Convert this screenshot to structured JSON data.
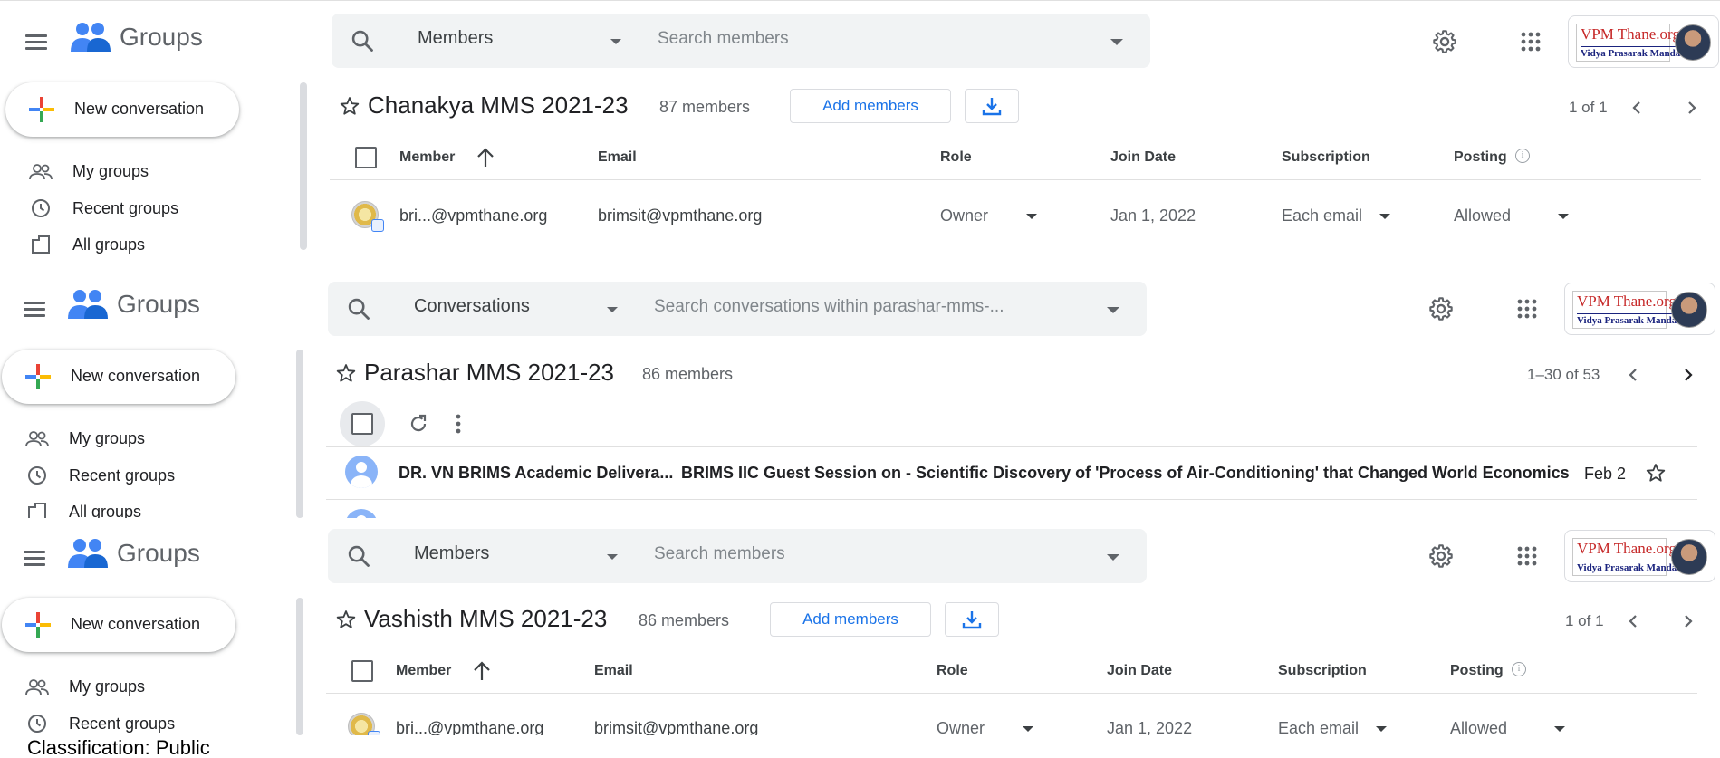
{
  "app": {
    "name": "Groups",
    "new_conversation_label": "New conversation"
  },
  "nav": {
    "my_groups": "My groups",
    "recent_groups": "Recent groups",
    "all_groups": "All groups"
  },
  "brand": {
    "line1": "VPM Thane.org",
    "line2": "Vidya Prasarak Mandal"
  },
  "colors": {
    "accent": "#1a73e8",
    "search_bg": "#f1f3f4",
    "muted": "#5f6368"
  },
  "panels": [
    {
      "search": {
        "scope": "Members",
        "placeholder": "Search members"
      },
      "group": {
        "title": "Chanakya MMS 2021-23",
        "member_count": "87 members"
      },
      "add_members_label": "Add members",
      "pager": "1 of 1",
      "table": {
        "headers": {
          "member": "Member",
          "email": "Email",
          "role": "Role",
          "join_date": "Join Date",
          "subscription": "Subscription",
          "posting": "Posting"
        },
        "rows": [
          {
            "member": "bri...@vpmthane.org",
            "email": "brimsit@vpmthane.org",
            "role": "Owner",
            "join_date": "Jan 1, 2022",
            "subscription": "Each email",
            "posting": "Allowed"
          }
        ]
      }
    },
    {
      "search": {
        "scope": "Conversations",
        "placeholder": "Search conversations within parashar-mms-..."
      },
      "group": {
        "title": "Parashar MMS 2021-23",
        "member_count": "86 members"
      },
      "pager": "1–30 of 53",
      "conversations": [
        {
          "sender": "DR. VN BRIMS Academic Delivera...",
          "subject": "BRIMS IIC Guest Session on - Scientific Discovery of 'Process of Air-Conditioning' that Changed World Economics",
          "date": "Feb 2"
        }
      ]
    },
    {
      "search": {
        "scope": "Members",
        "placeholder": "Search members"
      },
      "group": {
        "title": "Vashisth MMS 2021-23",
        "member_count": "86 members"
      },
      "add_members_label": "Add members",
      "pager": "1 of 1",
      "table": {
        "headers": {
          "member": "Member",
          "email": "Email",
          "role": "Role",
          "join_date": "Join Date",
          "subscription": "Subscription",
          "posting": "Posting"
        },
        "rows": [
          {
            "member": "bri...@vpmthane.org",
            "email": "brimsit@vpmthane.org",
            "role": "Owner",
            "join_date": "Jan 1, 2022",
            "subscription": "Each email",
            "posting": "Allowed"
          }
        ]
      }
    }
  ],
  "footer": {
    "classification": "Classification: Public"
  }
}
